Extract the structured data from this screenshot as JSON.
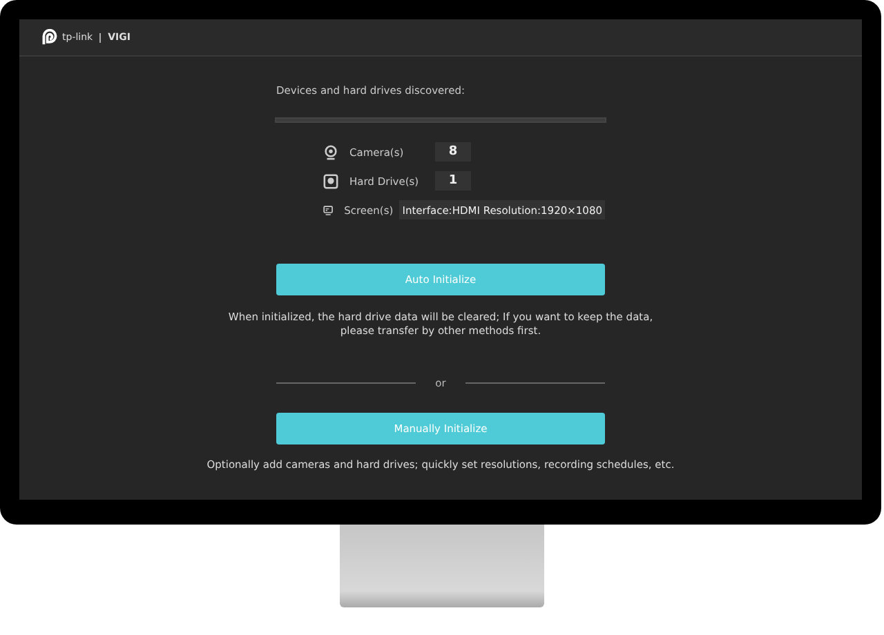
{
  "header": {
    "brand": "tp-link",
    "product": "VIGI"
  },
  "heading": "Devices and hard drives discovered:",
  "devices": [
    {
      "kind": "camera",
      "label": "Camera(s)",
      "value": "8"
    },
    {
      "kind": "drive",
      "label": "Hard Drive(s)",
      "value": "1"
    },
    {
      "kind": "screen",
      "label": "Screen(s)",
      "value": "Interface:HDMI Resolution:1920×1080"
    }
  ],
  "auto_button": "Auto Initialize",
  "auto_note": "When initialized, the hard drive data will be cleared; If you want to keep the data, please transfer by other methods first.",
  "separator": "or",
  "manual_button": "Manually Initialize",
  "manual_note": "Optionally add cameras and hard drives; quickly set resolutions, recording schedules, etc."
}
